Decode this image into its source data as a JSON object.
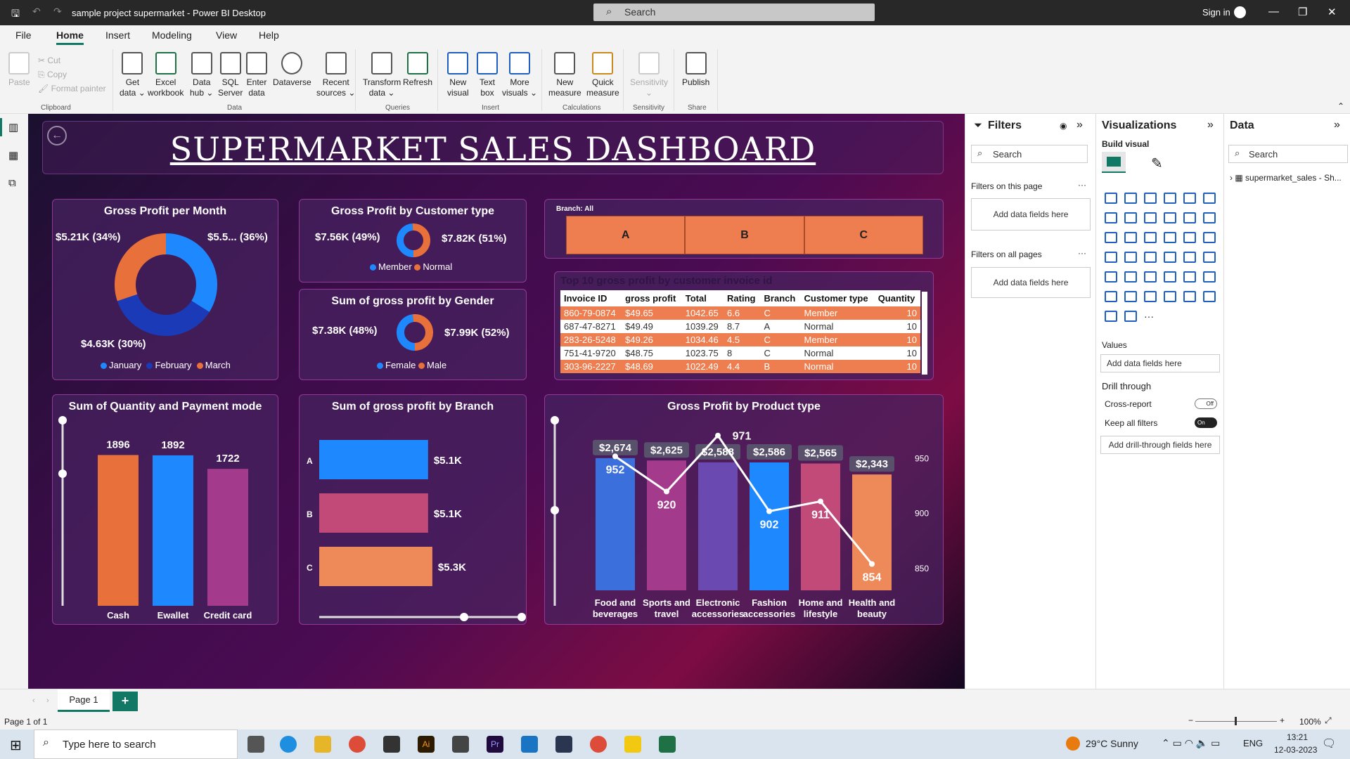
{
  "titlebar": {
    "title": "sample project supermarket - Power BI Desktop",
    "search_placeholder": "Search",
    "sign_in": "Sign in"
  },
  "menu": [
    "File",
    "Home",
    "Insert",
    "Modeling",
    "View",
    "Help"
  ],
  "ribbon": {
    "clipboard": [
      "Paste",
      "Cut",
      "Copy",
      "Format painter"
    ],
    "buttons": [
      {
        "l1": "Get",
        "l2": "data ⌄"
      },
      {
        "l1": "Excel",
        "l2": "workbook"
      },
      {
        "l1": "Data",
        "l2": "hub ⌄"
      },
      {
        "l1": "SQL",
        "l2": "Server"
      },
      {
        "l1": "Enter",
        "l2": "data"
      },
      {
        "l1": "Dataverse",
        "l2": ""
      },
      {
        "l1": "Recent",
        "l2": "sources ⌄"
      },
      {
        "l1": "Transform",
        "l2": "data ⌄"
      },
      {
        "l1": "Refresh",
        "l2": ""
      },
      {
        "l1": "New",
        "l2": "visual"
      },
      {
        "l1": "Text",
        "l2": "box"
      },
      {
        "l1": "More",
        "l2": "visuals ⌄"
      },
      {
        "l1": "New",
        "l2": "measure"
      },
      {
        "l1": "Quick",
        "l2": "measure"
      },
      {
        "l1": "Sensitivity",
        "l2": "⌄"
      },
      {
        "l1": "Publish",
        "l2": ""
      }
    ],
    "groups": [
      "Clipboard",
      "Data",
      "Queries",
      "Insert",
      "Calculations",
      "Sensitivity",
      "Share"
    ]
  },
  "dashboard": {
    "title": "SUPERMARKET SALES DASHBOARD",
    "gp_month": {
      "title": "Gross Profit per Month",
      "labels": [
        "$5.21K (34%)",
        "$5.5... (36%)",
        "$4.63K (30%)"
      ],
      "legend": [
        "January",
        "February",
        "March"
      ]
    },
    "gp_customer": {
      "title": "Gross Profit by Customer type",
      "labels": [
        "$7.56K (49%)",
        "$7.82K (51%)"
      ],
      "legend": [
        "Member",
        "Normal"
      ]
    },
    "gp_gender": {
      "title": "Sum of gross profit by Gender",
      "labels": [
        "$7.38K (48%)",
        "$7.99K (52%)"
      ],
      "legend": [
        "Female",
        "Male"
      ]
    },
    "branch_slicer": {
      "label": "Branch: All",
      "buttons": [
        "A",
        "B",
        "C"
      ]
    },
    "top10": {
      "title": "Top 10 gross profit by customer invoice id",
      "headers": [
        "Invoice ID",
        "gross profit",
        "Total",
        "Rating",
        "Branch",
        "Customer type",
        "Quantity"
      ],
      "rows": [
        [
          "860-79-0874",
          "$49.65",
          "1042.65",
          "6.6",
          "C",
          "Member",
          "10"
        ],
        [
          "687-47-8271",
          "$49.49",
          "1039.29",
          "8.7",
          "A",
          "Normal",
          "10"
        ],
        [
          "283-26-5248",
          "$49.26",
          "1034.46",
          "4.5",
          "C",
          "Member",
          "10"
        ],
        [
          "751-41-9720",
          "$48.75",
          "1023.75",
          "8",
          "C",
          "Normal",
          "10"
        ],
        [
          "303-96-2227",
          "$48.69",
          "1022.49",
          "4.4",
          "B",
          "Normal",
          "10"
        ]
      ]
    },
    "qty_payment": {
      "title": "Sum of Quantity and Payment mode"
    },
    "gp_branch": {
      "title": "Sum of gross profit by Branch"
    },
    "gp_product": {
      "title": "Gross Profit by Product type"
    }
  },
  "chart_data": [
    {
      "type": "pie",
      "title": "Gross Profit per Month",
      "categories": [
        "January",
        "February",
        "March"
      ],
      "values": [
        5210,
        5500,
        4630
      ],
      "labels": [
        "$5.21K (34%)",
        "$5.5... (36%)",
        "$4.63K (30%)"
      ],
      "colors": [
        "#1e88ff",
        "#1a3ab8",
        "#e8703a"
      ]
    },
    {
      "type": "pie",
      "title": "Gross Profit by Customer type",
      "categories": [
        "Member",
        "Normal"
      ],
      "values": [
        7560,
        7820
      ],
      "colors": [
        "#1e88ff",
        "#e8703a"
      ]
    },
    {
      "type": "pie",
      "title": "Sum of gross profit by Gender",
      "categories": [
        "Female",
        "Male"
      ],
      "values": [
        7380,
        7990
      ],
      "colors": [
        "#1e88ff",
        "#e8703a"
      ]
    },
    {
      "type": "bar",
      "title": "Sum of Quantity and Payment mode",
      "categories": [
        "Cash",
        "Ewallet",
        "Credit card"
      ],
      "values": [
        1896,
        1892,
        1722
      ],
      "colors": [
        "#e8703a",
        "#1e88ff",
        "#a43a8c"
      ]
    },
    {
      "type": "bar",
      "title": "Sum of gross profit by Branch",
      "orientation": "horizontal",
      "categories": [
        "A",
        "B",
        "C"
      ],
      "values": [
        5100,
        5100,
        5300
      ],
      "labels": [
        "$5.1K",
        "$5.1K",
        "$5.3K"
      ],
      "colors": [
        "#1e88ff",
        "#c24a78",
        "#ee8a5a"
      ]
    },
    {
      "type": "bar",
      "title": "Gross Profit by Product type",
      "categories": [
        "Food and beverages",
        "Sports and travel",
        "Electronic accessories",
        "Fashion accessories",
        "Home and lifestyle",
        "Health and beauty"
      ],
      "series": [
        {
          "values": [
            2674,
            2625,
            2588,
            2586,
            2565,
            2343
          ],
          "labels": [
            "$2,674",
            "$2,625",
            "$2,588",
            "$2,586",
            "$2,565",
            "$2,343"
          ]
        },
        {
          "type": "line",
          "values": [
            952,
            920,
            971,
            902,
            911,
            854
          ]
        }
      ],
      "y2ticks": [
        "950",
        "900",
        "850"
      ],
      "y2lim": [
        830,
        990
      ],
      "colors": [
        "#3a6fdc",
        "#a43a8c",
        "#6a4ab0",
        "#1e88ff",
        "#c24a78",
        "#ee8a5a"
      ]
    }
  ],
  "filters": {
    "title": "Filters",
    "search": "Search",
    "on_page": "Filters on this page",
    "all_pages": "Filters on all pages",
    "add": "Add data fields here"
  },
  "viz": {
    "title": "Visualizations",
    "build": "Build visual",
    "values": "Values",
    "add": "Add data fields here",
    "drill": "Drill through",
    "cross": "Cross-report",
    "cross_state": "Off",
    "keep": "Keep all filters",
    "keep_state": "On",
    "add_drill": "Add drill-through fields here"
  },
  "data": {
    "title": "Data",
    "search": "Search",
    "table": "supermarket_sales - Sh..."
  },
  "tabs": {
    "page": "Page 1",
    "add": "+"
  },
  "status": {
    "pages": "Page 1 of 1",
    "zoom": "100%"
  },
  "taskbar": {
    "search": "Type here to search",
    "weather": "29°C  Sunny",
    "lang": "ENG",
    "time": "13:21",
    "date": "12-03-2023"
  }
}
